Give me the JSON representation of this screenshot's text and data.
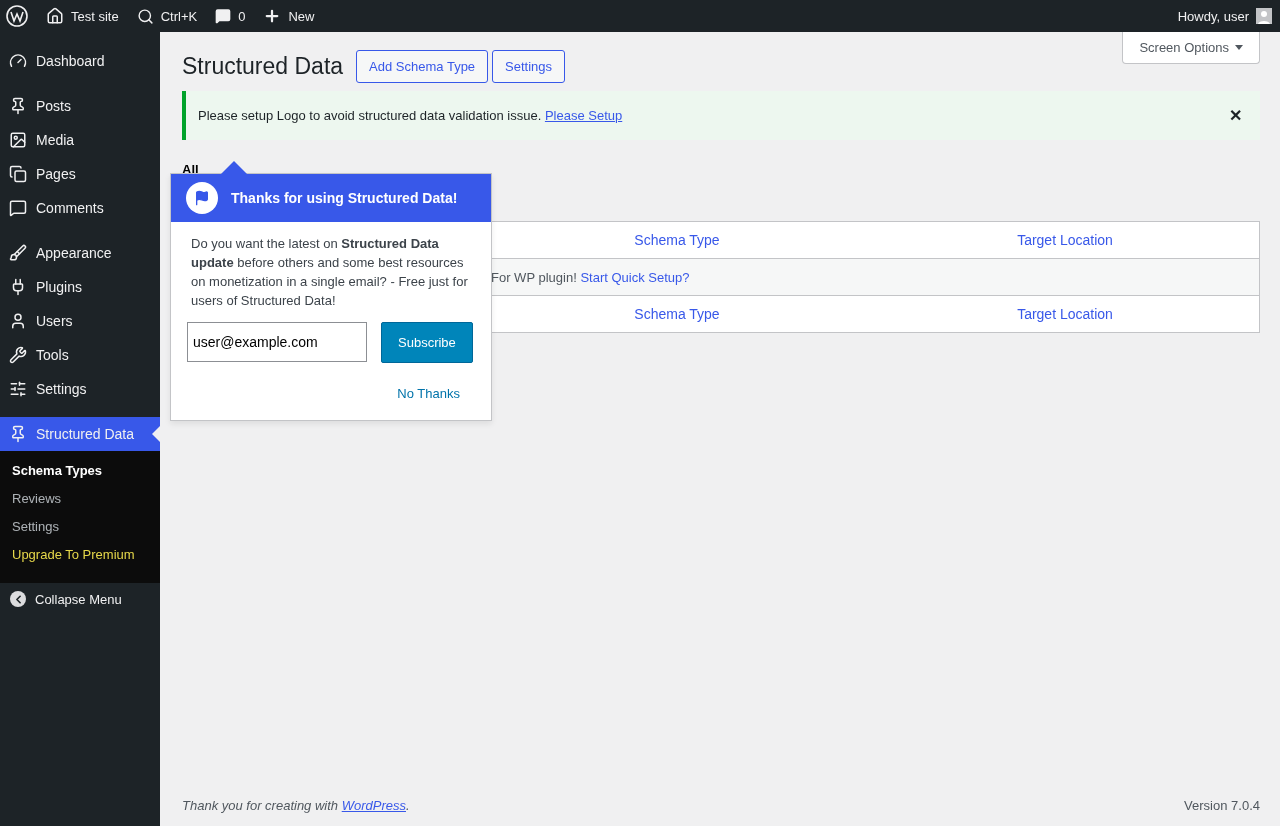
{
  "admin_bar": {
    "site": "Test site",
    "search": "Ctrl+K",
    "comments": "0",
    "new": "New",
    "greeting": "Howdy, user"
  },
  "sidebar": {
    "groups": [
      [
        {
          "label": "Dashboard",
          "selected": false
        }
      ],
      [
        {
          "label": "Posts",
          "selected": false
        },
        {
          "label": "Media",
          "selected": false
        },
        {
          "label": "Pages",
          "selected": false
        },
        {
          "label": "Comments",
          "selected": false
        }
      ],
      [
        {
          "label": "Appearance",
          "selected": false
        },
        {
          "label": "Plugins",
          "selected": false
        },
        {
          "label": "Users",
          "selected": false
        },
        {
          "label": "Tools",
          "selected": false
        },
        {
          "label": "Settings",
          "selected": false
        }
      ],
      [
        {
          "label": "Structured Data",
          "selected": true
        }
      ]
    ],
    "submenu": [
      {
        "label": "Schema Types",
        "selected": true,
        "kind": "normal"
      },
      {
        "label": "Reviews",
        "selected": false,
        "kind": "normal"
      },
      {
        "label": "Settings",
        "selected": false,
        "kind": "normal"
      },
      {
        "label": "Upgrade To Premium",
        "selected": false,
        "kind": "premium"
      }
    ],
    "collapse": "Collapse Menu"
  },
  "screen_options": "Screen Options",
  "page": {
    "title": "Structured Data",
    "buttons": [
      "Add Schema Type",
      "Settings"
    ]
  },
  "notice": {
    "text": "Please setup Logo to avoid structured data validation issue.",
    "link": " Please Setup",
    "close": "✕"
  },
  "filters": {
    "label": "All"
  },
  "table": {
    "columns": [
      "Schema Type",
      "Target Location"
    ],
    "message": "For WP plugin!",
    "message_link": "Start Quick Setup?",
    "footer_columns": [
      "Schema Type",
      "Target Location"
    ]
  },
  "popup": {
    "title": "Thanks for using Structured Data!",
    "body": "Do you want the latest on **Structured Data update** before others and some best resources on monetization in a single email? - Free just for users of Structured Data!",
    "email": "user@example.com",
    "subscribe": "Subscribe",
    "dismiss": "No Thanks"
  },
  "footer": {
    "text": "Thank you for creating with ",
    "link": "WordPress",
    "after": ".",
    "version": "Version 7.0.4"
  }
}
